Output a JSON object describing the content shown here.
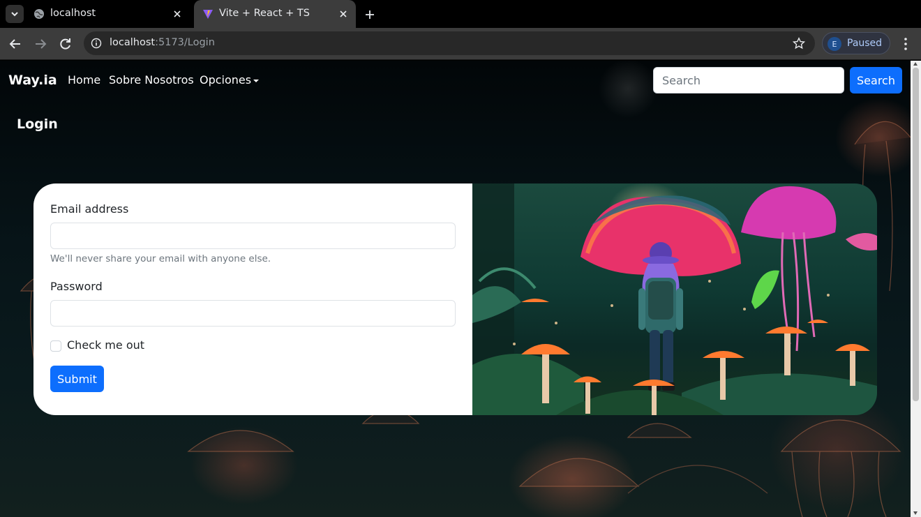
{
  "browser": {
    "tabs": [
      {
        "title": "localhost",
        "active": false
      },
      {
        "title": "Vite + React + TS",
        "active": true
      }
    ],
    "address": {
      "host": "localhost",
      "path": ":5173/Login"
    },
    "profile": {
      "initial": "E",
      "status": "Paused"
    }
  },
  "navbar": {
    "brand": "Way.ia",
    "links": [
      "Home",
      "Sobre Nosotros",
      "Opciones"
    ],
    "search_placeholder": "Search",
    "search_button": "Search"
  },
  "page": {
    "title": "Login"
  },
  "form": {
    "email_label": "Email address",
    "email_help": "We'll never share your email with anyone else.",
    "password_label": "Password",
    "remember_label": "Check me out",
    "submit_label": "Submit"
  },
  "theme": {
    "primary": "#0d6efd",
    "mushroom_red": "#e8326a",
    "mushroom_pink": "#d63ab0",
    "foliage": "#2a8a5a"
  }
}
